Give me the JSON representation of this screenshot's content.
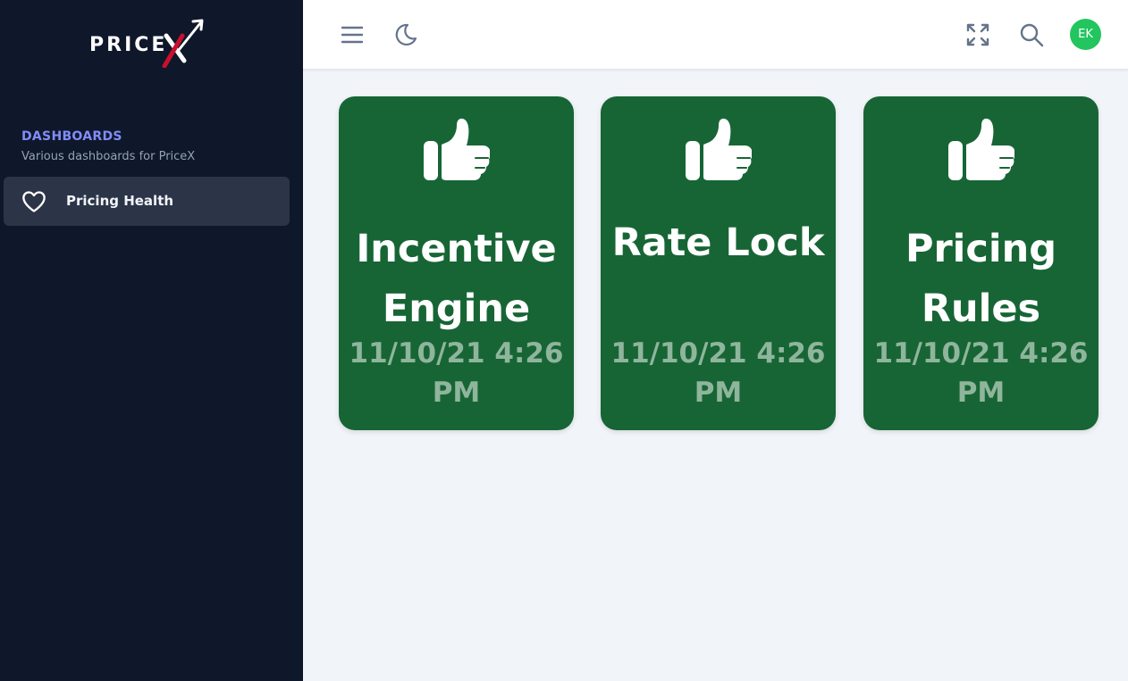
{
  "app": {
    "logo_text": "PRICE"
  },
  "sidebar": {
    "section_title": "DASHBOARDS",
    "section_subtitle": "Various dashboards for PriceX",
    "items": [
      {
        "label": "Pricing Health",
        "icon": "heart-icon",
        "active": true
      }
    ]
  },
  "topbar": {
    "left_icons": [
      "menu-icon",
      "moon-icon"
    ],
    "right_icons": [
      "fullscreen-icon",
      "search-icon"
    ],
    "avatar_initials": "EK",
    "avatar_color": "#22c55e"
  },
  "cards": [
    {
      "title": "Incentive Engine",
      "timestamp": "11/10/21 4:26 PM",
      "icon": "thumbs-up-icon"
    },
    {
      "title": "Rate Lock",
      "timestamp": "11/10/21 4:26 PM",
      "icon": "thumbs-up-icon"
    },
    {
      "title": "Pricing Rules",
      "timestamp": "11/10/21 4:26 PM",
      "icon": "thumbs-up-icon"
    }
  ],
  "colors": {
    "sidebar_bg": "#0f172a",
    "card_bg": "#176535",
    "accent": "#818cf8",
    "logo_accent": "#c8102e"
  }
}
